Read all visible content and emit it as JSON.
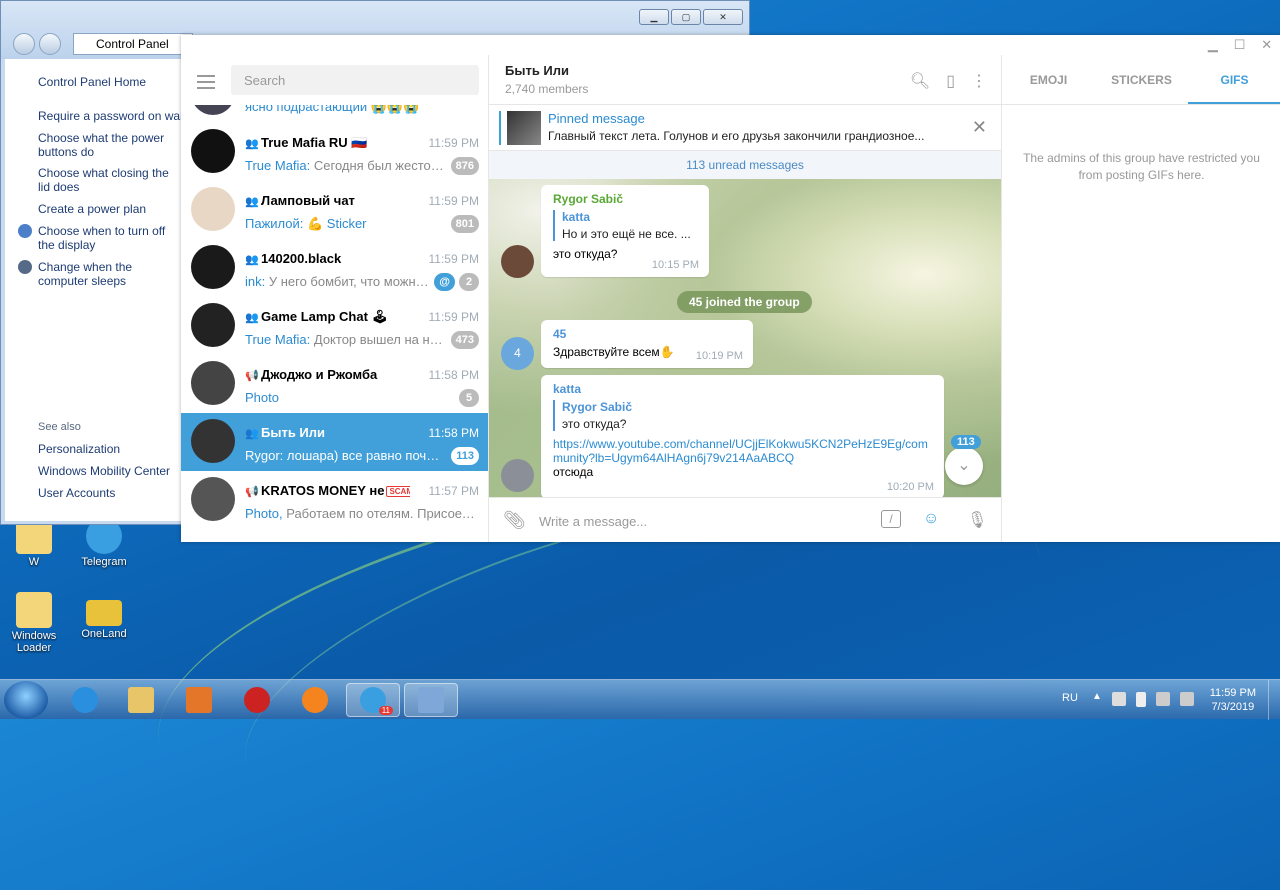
{
  "desktop": {
    "icons": [
      {
        "label": "W"
      },
      {
        "label": "Telegram"
      },
      {
        "label": "Windows Loader"
      },
      {
        "label": "OneLand"
      }
    ]
  },
  "control_panel": {
    "address": "Control Panel",
    "home": "Control Panel Home",
    "links": [
      "Require a password on wakeup",
      "Choose what the power buttons do",
      "Choose what closing the lid does",
      "Create a power plan",
      "Choose when to turn off the display",
      "Change when the computer sleeps"
    ],
    "see_also": "See also",
    "see_also_links": [
      "Personalization",
      "Windows Mobility Center",
      "User Accounts"
    ]
  },
  "telegram": {
    "search_placeholder": "Search",
    "top_partial": {
      "text": "ясно подрастающий 😭😭😭"
    },
    "dialogs": [
      {
        "name": "True Mafia RU 🇷🇺",
        "time": "11:59 PM",
        "sender": "True Mafia:",
        "text": " Сегодня был жестоко...",
        "badge": "876",
        "color": "#111"
      },
      {
        "name": "Ламповый чат",
        "time": "11:59 PM",
        "sender": "Пажилой:",
        "text": " 💪 Sticker",
        "badge": "801",
        "color": "#e8d7c5"
      },
      {
        "name": "140200.black",
        "time": "11:59 PM",
        "sender": "ink:",
        "text": " У него бомбит, что можно ...",
        "badge": "2",
        "mention": "@",
        "color": "#1a1a1a"
      },
      {
        "name": "Game Lamp Chat 🕹",
        "time": "11:59 PM",
        "sender": "True Mafia:",
        "text": " Доктор вышел на но...",
        "badge": "473",
        "color": "#222"
      },
      {
        "name": "Джоджо и Ржомба",
        "time": "11:58 PM",
        "sender": "Photo",
        "text": "",
        "badge": "5",
        "color": "#444"
      },
      {
        "name": "Быть Или",
        "time": "11:58 PM",
        "sender": "Rygor:",
        "text": " лошара) все равно почти ...",
        "badge": "113",
        "color": "#333"
      },
      {
        "name": "KRATOS MONEY не",
        "scam": "SCAM",
        "time": "11:57 PM",
        "sender": "Photo,",
        "text": " Работаем по отелям. Присоеди...",
        "badge": "",
        "color": "#555"
      }
    ],
    "chat": {
      "title": "Быть Или",
      "subtitle": "2,740 members",
      "pinned_label": "Pinned message",
      "pinned_text": "Главный текст лета. Голунов и его друзья закончили грандиозное...",
      "unread": "113 unread messages",
      "msg1": {
        "author": "Rygor Sabič",
        "reply_author": "katta",
        "reply_text": "Но и это ещё не все. ...",
        "text": "это откуда?",
        "time": "10:15 PM"
      },
      "service": "45 joined the group",
      "msg2": {
        "author": "45",
        "avatar": "4",
        "text": "Здравствуйте всем✋",
        "time": "10:19 PM"
      },
      "msg3": {
        "author": "katta",
        "reply_author": "Rygor Sabič",
        "reply_text": "это откуда?",
        "link": "https://www.youtube.com/channel/UCjjElKokwu5KCN2PeHzE9Eg/community?lb=Ugym64AlHAgn6j79v214AaABCQ",
        "text": "отсюда",
        "time": "10:20 PM"
      },
      "scroll_badge": "113",
      "compose_placeholder": "Write a message..."
    },
    "panel": {
      "tabs": [
        "EMOJI",
        "STICKERS",
        "GIFS"
      ],
      "restricted": "The admins of this group have restricted you from posting GIFs here."
    }
  },
  "taskbar": {
    "lang": "RU",
    "time": "11:59 PM",
    "date": "7/3/2019",
    "telegram_badge": "11"
  }
}
